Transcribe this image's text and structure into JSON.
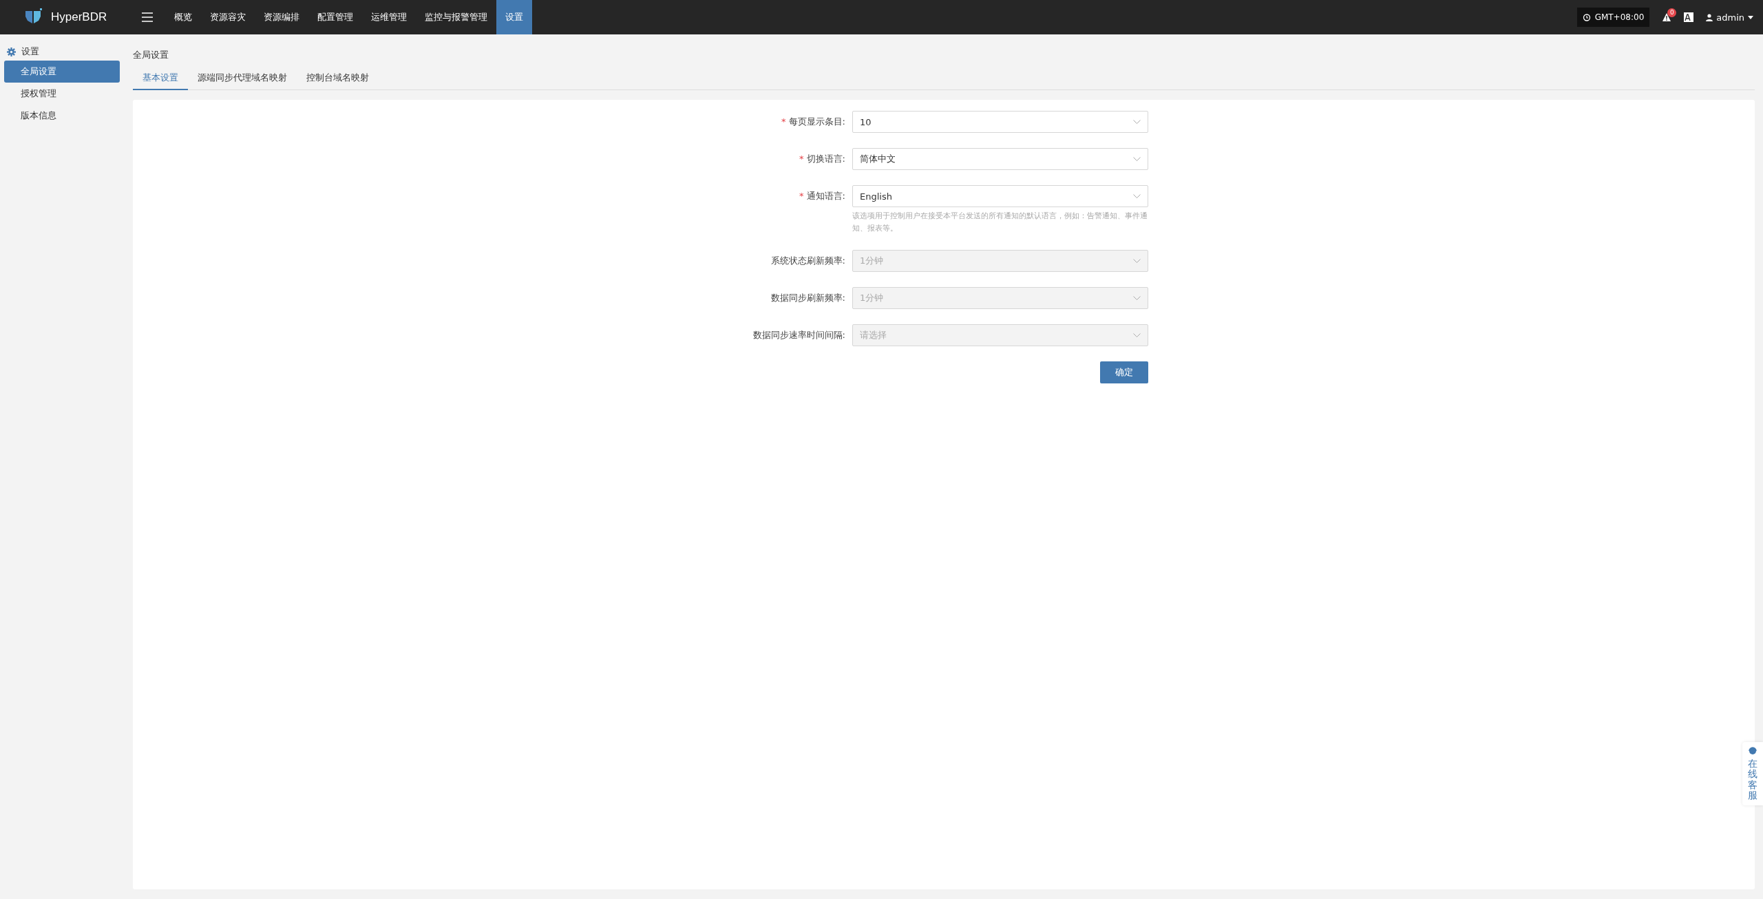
{
  "topbar": {
    "brand": "HyperBDR",
    "nav": [
      {
        "label": "概览",
        "selected": false
      },
      {
        "label": "资源容灾",
        "selected": false
      },
      {
        "label": "资源编排",
        "selected": false
      },
      {
        "label": "配置管理",
        "selected": false
      },
      {
        "label": "运维管理",
        "selected": false
      },
      {
        "label": "监控与报警管理",
        "selected": false
      },
      {
        "label": "设置",
        "selected": true
      }
    ],
    "timezone": "GMT+08:00",
    "alert_count": "0",
    "user": "admin"
  },
  "sidebar": {
    "title": "设置",
    "items": [
      {
        "label": "全局设置",
        "selected": true
      },
      {
        "label": "授权管理",
        "selected": false
      },
      {
        "label": "版本信息",
        "selected": false
      }
    ]
  },
  "page": {
    "title": "全局设置",
    "tabs": [
      {
        "label": "基本设置",
        "selected": true
      },
      {
        "label": "源端同步代理域名映射",
        "selected": false
      },
      {
        "label": "控制台域名映射",
        "selected": false
      }
    ]
  },
  "form": {
    "fields": [
      {
        "label": "每页显示条目:",
        "required_mark": "*",
        "disabled": false,
        "value": "10"
      },
      {
        "label": "切换语言:",
        "required_mark": "*",
        "disabled": false,
        "value": "简体中文"
      },
      {
        "label": "通知语言:",
        "required_mark": "*",
        "disabled": false,
        "value": "English",
        "help": "该选项用于控制用户在接受本平台发送的所有通知的默认语言，例如：告警通知、事件通知、报表等。"
      },
      {
        "label": "系统状态刷新频率:",
        "disabled": true,
        "value": "1分钟"
      },
      {
        "label": "数据同步刷新频率:",
        "disabled": true,
        "value": "1分钟"
      },
      {
        "label": "数据同步速率时间间隔:",
        "disabled": true,
        "placeholder": "请选择"
      }
    ],
    "submit": "确定"
  },
  "support": {
    "label": "在线客服"
  }
}
